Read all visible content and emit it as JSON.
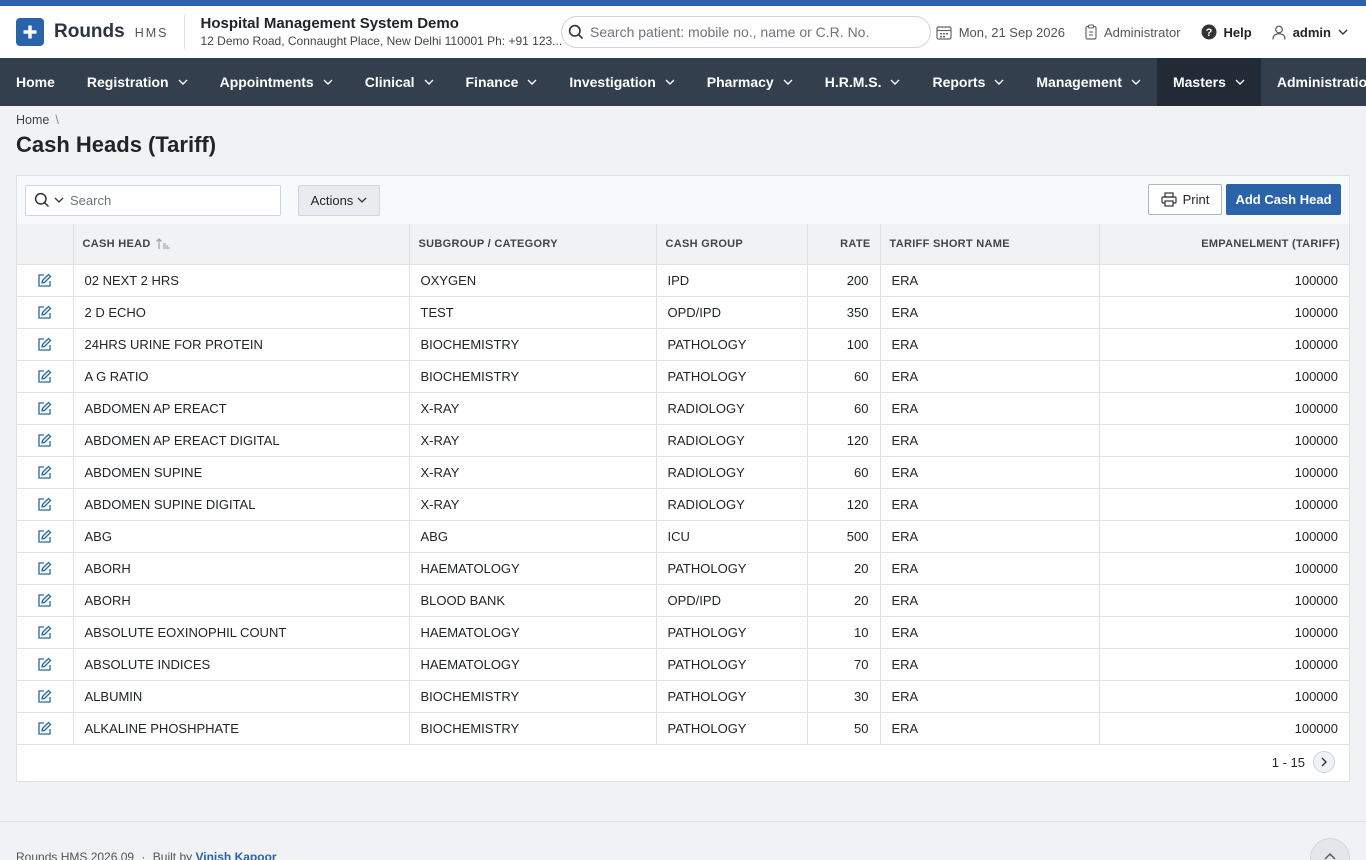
{
  "header": {
    "logo_name": "Rounds",
    "logo_suffix": "HMS",
    "hospital_name": "Hospital Management System Demo",
    "hospital_address": "12 Demo Road, Connaught Place, New Delhi 110001 Ph: +91 123...",
    "search_placeholder": "Search patient: mobile no., name or C.R. No.",
    "date": "Mon, 21 Sep 2026",
    "role": "Administrator",
    "help": "Help",
    "user": "admin"
  },
  "nav": {
    "items": [
      {
        "label": "Home"
      },
      {
        "label": "Registration"
      },
      {
        "label": "Appointments"
      },
      {
        "label": "Clinical"
      },
      {
        "label": "Finance"
      },
      {
        "label": "Investigation"
      },
      {
        "label": "Pharmacy"
      },
      {
        "label": "H.R.M.S."
      },
      {
        "label": "Reports"
      },
      {
        "label": "Management"
      },
      {
        "label": "Masters"
      },
      {
        "label": "Administration"
      }
    ]
  },
  "breadcrumb": {
    "home": "Home",
    "separator": "\\"
  },
  "page": {
    "title": "Cash Heads (Tariff)"
  },
  "toolbar": {
    "search_placeholder": "Search",
    "actions_label": "Actions",
    "print_label": "Print",
    "add_label": "Add Cash Head"
  },
  "table": {
    "headers": [
      "CASH HEAD",
      "SUBGROUP / CATEGORY",
      "CASH GROUP",
      "RATE",
      "TARIFF SHORT NAME",
      "EMPANELMENT (TARIFF)"
    ],
    "rows": [
      [
        "02 NEXT 2 HRS",
        "OXYGEN",
        "IPD",
        "200",
        "ERA",
        "100000"
      ],
      [
        "2 D ECHO",
        "TEST",
        "OPD/IPD",
        "350",
        "ERA",
        "100000"
      ],
      [
        "24HRS URINE FOR PROTEIN",
        "BIOCHEMISTRY",
        "PATHOLOGY",
        "100",
        "ERA",
        "100000"
      ],
      [
        "A G RATIO",
        "BIOCHEMISTRY",
        "PATHOLOGY",
        "60",
        "ERA",
        "100000"
      ],
      [
        "ABDOMEN AP EREACT",
        "X-RAY",
        "RADIOLOGY",
        "60",
        "ERA",
        "100000"
      ],
      [
        "ABDOMEN AP EREACT DIGITAL",
        "X-RAY",
        "RADIOLOGY",
        "120",
        "ERA",
        "100000"
      ],
      [
        "ABDOMEN SUPINE",
        "X-RAY",
        "RADIOLOGY",
        "60",
        "ERA",
        "100000"
      ],
      [
        "ABDOMEN SUPINE DIGITAL",
        "X-RAY",
        "RADIOLOGY",
        "120",
        "ERA",
        "100000"
      ],
      [
        "ABG",
        "ABG",
        "ICU",
        "500",
        "ERA",
        "100000"
      ],
      [
        "ABORH",
        "HAEMATOLOGY",
        "PATHOLOGY",
        "20",
        "ERA",
        "100000"
      ],
      [
        "ABORH",
        "BLOOD BANK",
        "OPD/IPD",
        "20",
        "ERA",
        "100000"
      ],
      [
        "ABSOLUTE EOXINOPHIL COUNT",
        "HAEMATOLOGY",
        "PATHOLOGY",
        "10",
        "ERA",
        "100000"
      ],
      [
        "ABSOLUTE INDICES",
        "HAEMATOLOGY",
        "PATHOLOGY",
        "70",
        "ERA",
        "100000"
      ],
      [
        "ALBUMIN",
        "BIOCHEMISTRY",
        "PATHOLOGY",
        "30",
        "ERA",
        "100000"
      ],
      [
        "ALKALINE PHOSHPHATE",
        "BIOCHEMISTRY",
        "PATHOLOGY",
        "50",
        "ERA",
        "100000"
      ]
    ]
  },
  "pager": {
    "range": "1 - 15"
  },
  "footer": {
    "version": "Rounds HMS 2026.09",
    "dot": "·",
    "built_by": "Built by",
    "author": "Vinish Kapoor"
  },
  "colors": {
    "brand": "#2a63aa",
    "navbar": "#343f4d",
    "nav_active": "#212a35"
  },
  "icons": [
    "plus-icon",
    "search-icon",
    "calendar-icon",
    "clipboard-icon",
    "help-icon",
    "user-icon",
    "chevron-down-icon",
    "print-icon",
    "edit-icon",
    "chevron-right-icon",
    "chevron-up-icon",
    "sort-icon"
  ]
}
